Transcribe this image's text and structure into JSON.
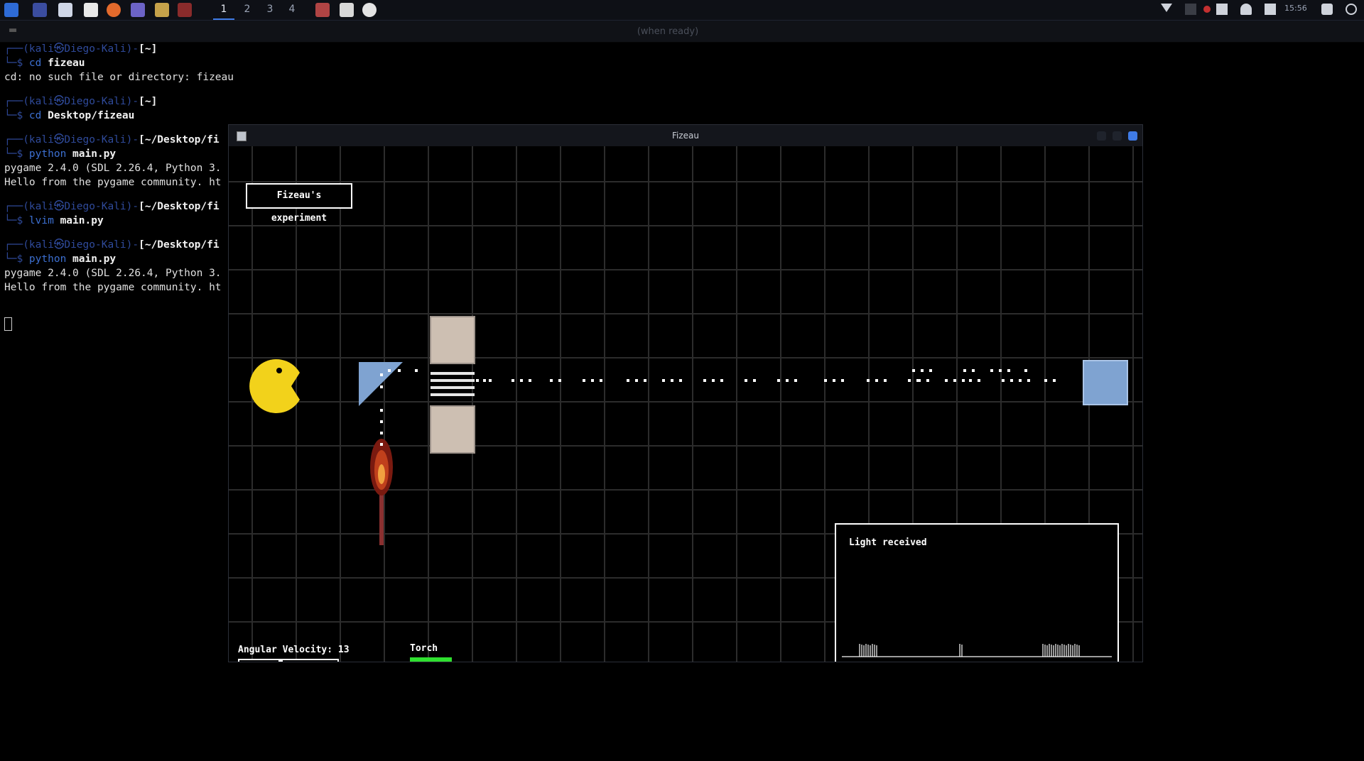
{
  "taskbar": {
    "workspaces": [
      "1",
      "2",
      "3",
      "4"
    ],
    "active_workspace": "1",
    "clock": "15:56"
  },
  "terminal": {
    "window_title": "(when ready)",
    "lines": [
      {
        "type": "prompt",
        "user": "(kali㉿Diego-Kali)",
        "path": "[~]"
      },
      {
        "type": "command",
        "cmd": "cd",
        "args": "fizeau"
      },
      {
        "type": "output",
        "text": "cd: no such file or directory: fizeau"
      },
      {
        "type": "prompt",
        "user": "(kali㉿Diego-Kali)",
        "path": "[~]"
      },
      {
        "type": "command",
        "cmd": "cd",
        "args": "Desktop/fizeau"
      },
      {
        "type": "prompt",
        "user": "(kali㉿Diego-Kali)",
        "path": "[~/Desktop/fi"
      },
      {
        "type": "command",
        "cmd": "python",
        "args": "main.py"
      },
      {
        "type": "output",
        "text": "pygame 2.4.0 (SDL 2.26.4, Python 3."
      },
      {
        "type": "output",
        "text": "Hello from the pygame community. ht"
      },
      {
        "type": "prompt",
        "user": "(kali㉿Diego-Kali)",
        "path": "[~/Desktop/fi"
      },
      {
        "type": "command",
        "cmd": "lvim",
        "args": "main.py"
      },
      {
        "type": "prompt",
        "user": "(kali㉿Diego-Kali)",
        "path": "[~/Desktop/fi"
      },
      {
        "type": "command",
        "cmd": "python",
        "args": "main.py"
      },
      {
        "type": "output",
        "text": "pygame 2.4.0 (SDL 2.26.4, Python 3."
      },
      {
        "type": "output",
        "text": "Hello from the pygame community. ht"
      }
    ]
  },
  "game": {
    "window_title": "Fizeau",
    "experiment_label": "Fizeau's experiment",
    "angular_velocity_label": "Angular Velocity: 13",
    "angular_velocity_value": 13,
    "slider_fraction": 0.42,
    "torch_label": "Torch",
    "light_panel_title": "Light received",
    "colors": {
      "background": "#000000",
      "grid": "#2c2c2c",
      "pacman": "#f2d21b",
      "mirror": "#7fa3d1",
      "wheel_block": "#cdbfb2",
      "torch_on": "#2fe02f",
      "light": "#ffffff"
    }
  }
}
